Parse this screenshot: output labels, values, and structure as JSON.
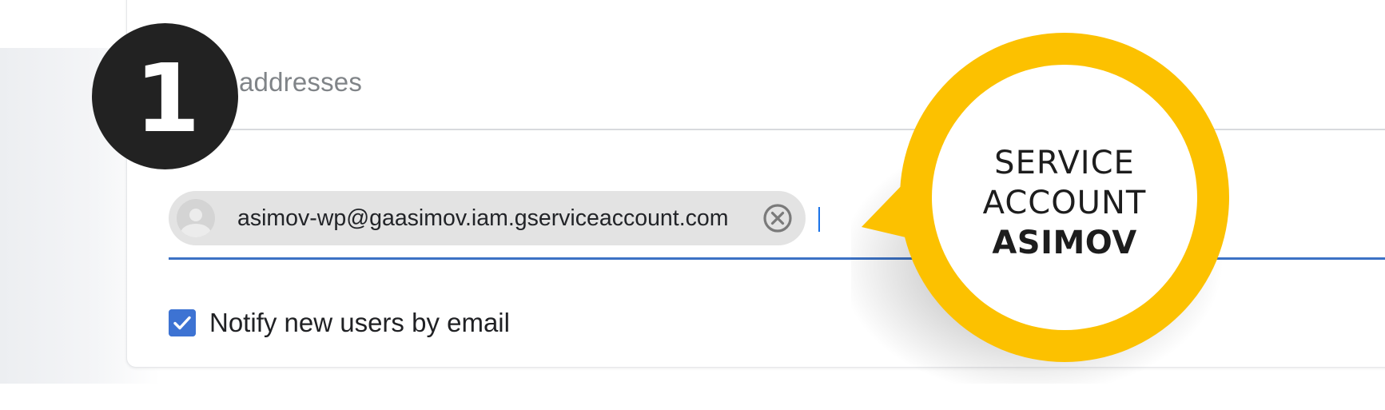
{
  "step": {
    "number": "1"
  },
  "section": {
    "label": "addresses"
  },
  "recipients": [
    {
      "email": "asimov-wp@gaasimov.iam.gserviceaccount.com",
      "avatar_icon": "person-avatar-icon",
      "remove_icon": "close-circle-icon"
    }
  ],
  "notify": {
    "label": "Notify new users by email",
    "checked": true
  },
  "callout": {
    "line1": "SERVICE",
    "line2": "ACCOUNT",
    "line3": "ASIMOV"
  },
  "colors": {
    "callout_ring": "#FCC100",
    "badge": "#222222",
    "accent_blue": "#3C72C5",
    "checkbox": "#3D73D3",
    "chip": "#E3E3E3"
  }
}
